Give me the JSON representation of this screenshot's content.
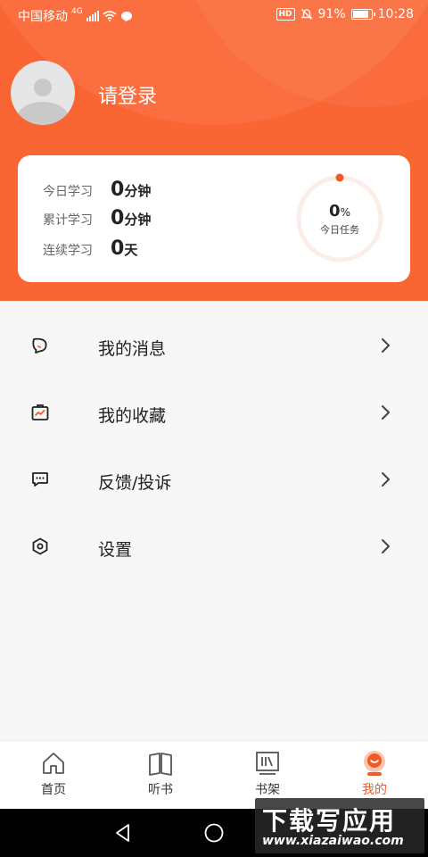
{
  "status_bar": {
    "carrier": "中国移动",
    "network": "4G",
    "hd": "HD",
    "battery": "91%",
    "battery_level": 0.91,
    "time": "10:28"
  },
  "profile": {
    "login_label": "请登录"
  },
  "stats": {
    "today_label": "今日学习",
    "today_value": "0",
    "today_unit": "分钟",
    "total_label": "累计学习",
    "total_value": "0",
    "total_unit": "分钟",
    "streak_label": "连续学习",
    "streak_value": "0",
    "streak_unit": "天",
    "task_percent": "0",
    "task_percent_unit": "%",
    "task_label": "今日任务",
    "progress_ring_color": "#f25a28"
  },
  "menu": {
    "items": [
      {
        "label": "我的消息",
        "icon": "message-icon"
      },
      {
        "label": "我的收藏",
        "icon": "favorites-icon"
      },
      {
        "label": "反馈/投诉",
        "icon": "feedback-icon"
      },
      {
        "label": "设置",
        "icon": "settings-icon"
      }
    ]
  },
  "tabbar": {
    "tabs": [
      {
        "label": "首页",
        "icon": "home-icon"
      },
      {
        "label": "听书",
        "icon": "book-icon"
      },
      {
        "label": "书架",
        "icon": "bookshelf-icon"
      },
      {
        "label": "我的",
        "icon": "profile-icon",
        "active": true
      }
    ]
  },
  "watermark": {
    "title": "下载写应用",
    "url": "www.xiazaiwao.com"
  },
  "colors": {
    "brand": "#fa6534",
    "accent": "#f25a28"
  }
}
